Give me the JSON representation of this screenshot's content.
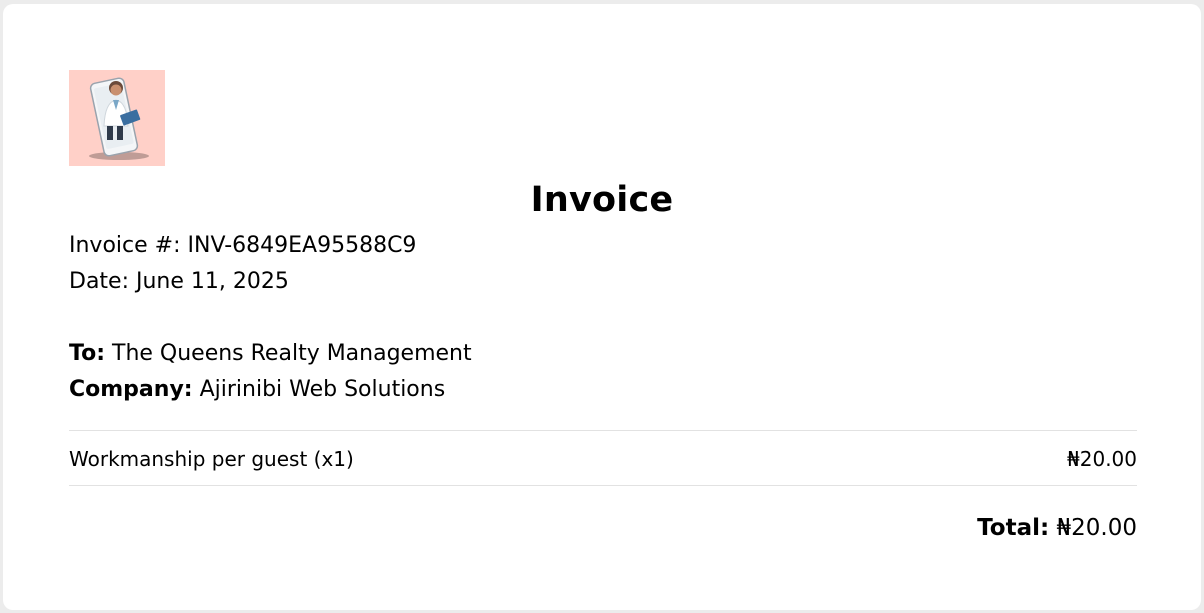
{
  "invoice": {
    "title": "Invoice",
    "number_label": "Invoice #:",
    "number": "INV-6849EA95588C9",
    "date_label": "Date:",
    "date": "June 11, 2025"
  },
  "billing": {
    "to_label": "To:",
    "to": "The Queens Realty Management",
    "company_label": "Company:",
    "company": "Ajirinibi Web Solutions"
  },
  "items": [
    {
      "description": "Workmanship per guest (x1)",
      "amount": "₦20.00"
    }
  ],
  "total": {
    "label": "Total:",
    "amount": "₦20.00"
  },
  "colors": {
    "logo_background": "#ffd0c8",
    "page_background": "#ececec",
    "card_background": "#ffffff",
    "divider": "#e2e2e2"
  }
}
